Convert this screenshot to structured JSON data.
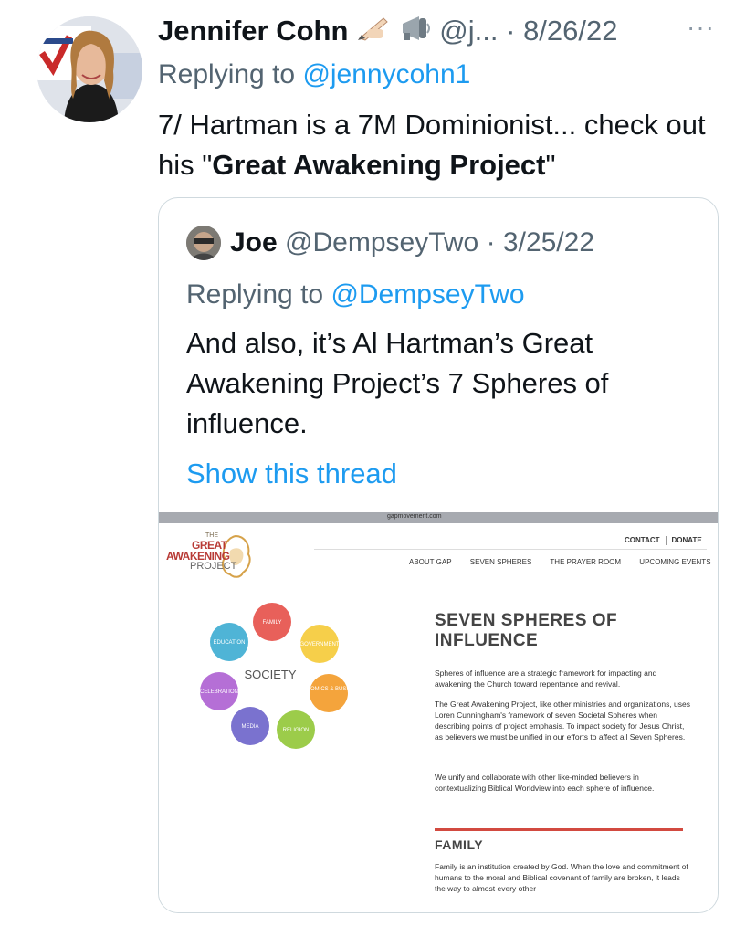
{
  "tweet": {
    "author_name": "Jennifer Cohn",
    "author_handle": "@j...",
    "separator": "·",
    "date": "8/26/22",
    "more": "···",
    "replying_prefix": "Replying to",
    "replying_to": "@jennycohn1",
    "text_before": "7/ Hartman is a 7M Dominionist... check out his \"",
    "text_bold": "Great Awakening Project",
    "text_after": "\""
  },
  "quote": {
    "author_name": "Joe",
    "author_handle": "@DempseyTwo",
    "separator": "·",
    "date": "3/25/22",
    "replying_prefix": "Replying to",
    "replying_to": "@DempseyTwo",
    "text": "And also, it’s Al Hartman’s Great Awakening Project’s 7 Spheres of influence.",
    "show_thread": "Show this thread"
  },
  "screenshot": {
    "url": "gapmovement.com",
    "logo": {
      "the": "THE",
      "great": "GREAT",
      "awakening": "AWAKENING",
      "project": "PROJECT"
    },
    "nav_top": [
      "CONTACT",
      "DONATE"
    ],
    "nav": [
      "ABOUT GAP",
      "SEVEN SPHERES",
      "THE PRAYER ROOM",
      "UPCOMING EVENTS"
    ],
    "heading": "SEVEN SPHERES OF INFLUENCE",
    "para1": "Spheres of influence are a strategic framework for impacting and awakening the Church toward repentance and revival.",
    "para2": "The Great Awakening Project, like other ministries and organizations, uses Loren Cunningham's framework of seven Societal Spheres when describing points of project emphasis. To impact society for Jesus Christ, as believers we must be unified in our efforts to affect all Seven Spheres.",
    "para3": "We unify and collaborate with other like-minded believers in contextualizing Biblical Worldview into each sphere of influence.",
    "subheading": "FAMILY",
    "para4": "Family is an institution created by God. When the love and commitment of humans to the moral and Biblical covenant of family are broken, it leads the way to almost every other",
    "center_label": "SOCIETY",
    "spheres": [
      {
        "label": "FAMILY",
        "color": "#e8605a"
      },
      {
        "label": "GOVERNMENT",
        "color": "#f6cf4a"
      },
      {
        "label": "ECONOMICS & BUSINESS",
        "color": "#f4a43c"
      },
      {
        "label": "RELIGION",
        "color": "#9ccc4a"
      },
      {
        "label": "MEDIA",
        "color": "#7a72cf"
      },
      {
        "label": "CELEBRATION",
        "color": "#b56fd6"
      },
      {
        "label": "EDUCATION",
        "color": "#4fb4d6"
      }
    ]
  }
}
